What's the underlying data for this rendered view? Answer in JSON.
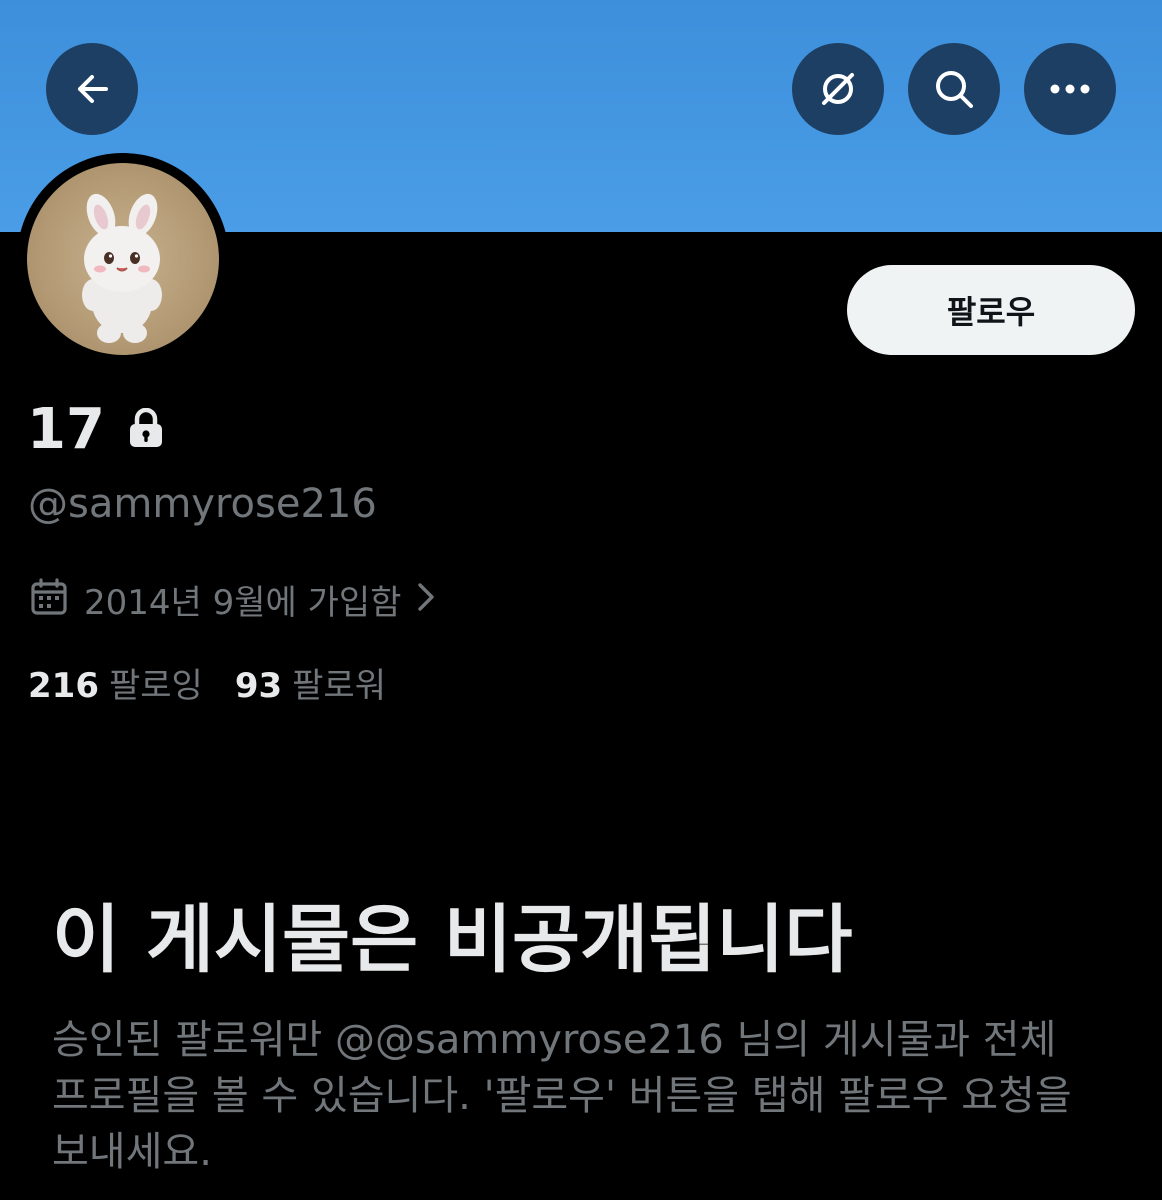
{
  "header": {
    "back_icon": "arrow-left-icon",
    "grok_icon": "grok-slash-icon",
    "search_icon": "search-icon",
    "more_icon": "more-horizontal-icon",
    "banner_color": "#4a9de6",
    "button_color": "#1d3f63"
  },
  "profile": {
    "follow_label": "팔로우",
    "display_name": "17",
    "protected_icon": "lock-icon",
    "handle": "@sammyrose216",
    "joined_icon": "calendar-icon",
    "joined_text": "2014년 9월에 가입함",
    "following_count": "216",
    "following_label": "팔로잉",
    "followers_count": "93",
    "followers_label": "팔로워"
  },
  "private_notice": {
    "title": "이 게시물은 비공개됩니다",
    "description": "승인된 팔로워만 @@sammyrose216 님의 게시물과 전체 프로필을 볼 수 있습니다. '팔로우' 버튼을 탭해 팔로우 요청을 보내세요."
  }
}
